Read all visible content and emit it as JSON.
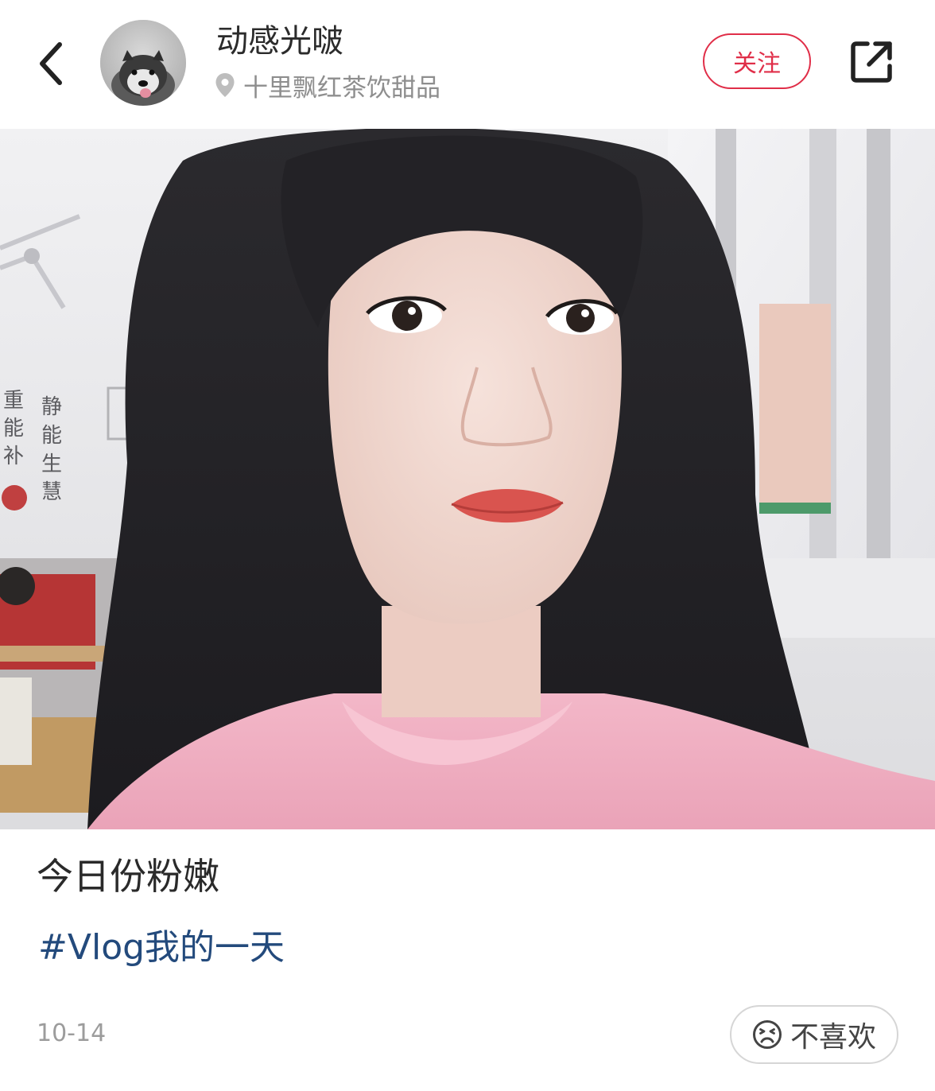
{
  "header": {
    "username": "动感光啵",
    "location": "十里飘红茶饮甜品",
    "follow_label": "关注",
    "icons": {
      "back": "chevron-left-icon",
      "location": "location-pin-icon",
      "share": "share-external-icon"
    },
    "accent_color": "#e02e48"
  },
  "post": {
    "caption": "今日份粉嫩",
    "hashtag": "#Vlog我的一天",
    "date": "10-14",
    "dislike_label": "不喜欢",
    "hashtag_color": "#234a7c"
  }
}
